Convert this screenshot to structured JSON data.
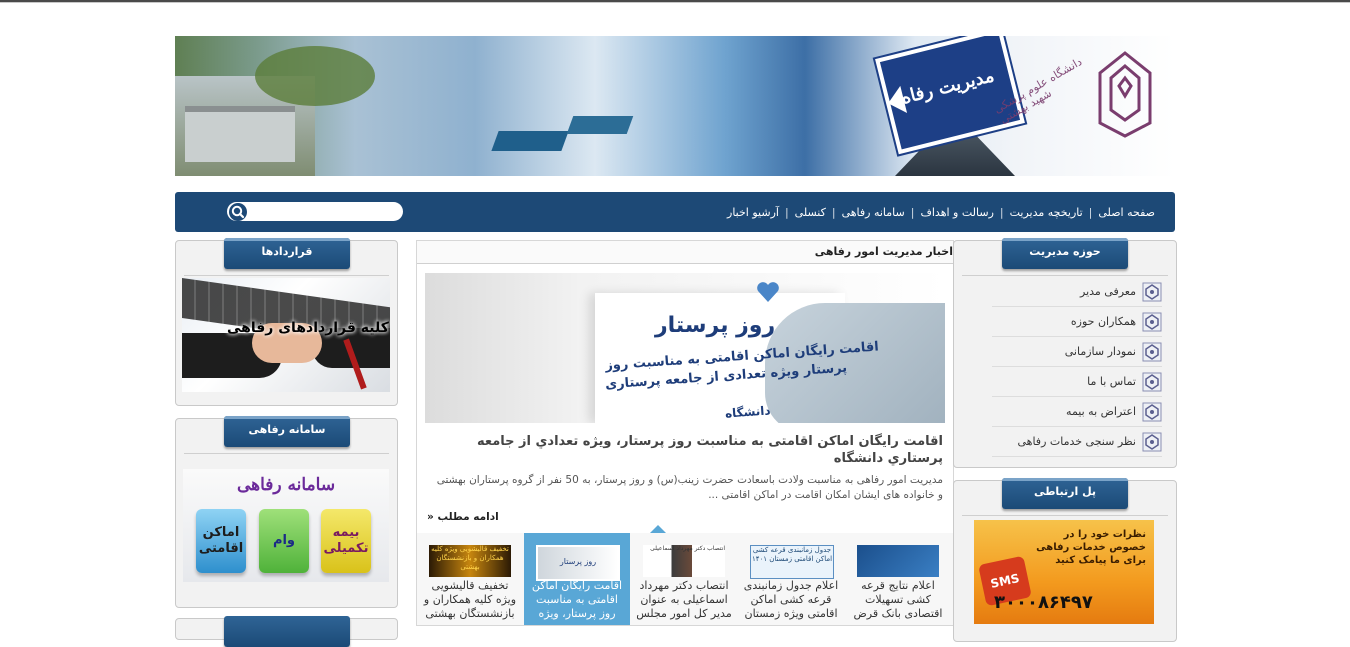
{
  "banner": {
    "sign_text": "مدیریت رفاه",
    "university_text": "دانشگاه علوم پزشکی شهید بهشتی"
  },
  "nav": {
    "items": [
      {
        "label": "صفحه اصلی"
      },
      {
        "label": "تاریخچه مدیریت"
      },
      {
        "label": "رسالت و اهداف"
      },
      {
        "label": "سامانه رفاهی"
      },
      {
        "label": "کنسلی"
      },
      {
        "label": "آرشیو اخبار"
      }
    ],
    "separator": "|",
    "search_placeholder": ""
  },
  "right_box": {
    "title": "حوزه مدیریت",
    "items": [
      {
        "label": "معرفی مدیر"
      },
      {
        "label": "همکاران حوزه"
      },
      {
        "label": "نمودار سازمانی"
      },
      {
        "label": "تماس با ما"
      },
      {
        "label": "اعتراض به بیمه"
      },
      {
        "label": "نظر سنجی خدمات رفاهی"
      }
    ]
  },
  "link_box": {
    "title": "پل ارتباطی",
    "sms_text": "نظرات خود را در خصوص خدمات رفاهی برای ما پیامک کنید",
    "sms_badge": "SMS",
    "sms_number": "۳۰۰۰۸۶۴۹۷"
  },
  "contracts_box": {
    "title": "قراردادها",
    "image_caption": "کلیه قراردادهای رفاهی"
  },
  "samaneh_box": {
    "title": "سامانه رفاهی",
    "image_title": "سامانه رفاهی",
    "cubes": [
      "بیمه تکمیلی",
      "وام",
      "اماکن اقامتی"
    ]
  },
  "news": {
    "section_title": "اخبار مدیریت امور رفاهی",
    "image_lines": [
      "روز پرستار",
      "اقامت رایگان اماکن اقامتی به مناسبت روز",
      "پرستار ویژه تعدادی از جامعه پرستاری",
      "دانشگاه"
    ],
    "headline": "اقامت رايگان اماكن اقامتی به مناسبت روز پرستار، ويژه تعدادي از جامعه پرستاري دانشگاه",
    "summary": "مدیریت امور رفاهی به مناسبت ولادت باسعادت حضرت زینب(س) و روز پرستار، به 50 نفر از گروه پرستاران بهشتی و خانواده های ایشان امکان اقامت در اماکن اقامتی ...",
    "more_label": "» ادامه مطلب",
    "thumbs": [
      {
        "text": "تخفیف قالیشویی ویژه کلیه همکاران و بازنشستگان بهشتی",
        "img_text": "تخفیف قالیشویی ویژه کلیه همکاران و بازنشستگان بهشتی"
      },
      {
        "text": "اقامت رايگان اماكن اقامتی به مناسبت روز پرستار، ويژه",
        "img_text": "روز پرستار"
      },
      {
        "text": "انتصاب دکتر مهرداد اسماعیلی به عنوان مدیر کل امور مجلس",
        "img_text": "انتصاب دکتر مهرداد اسماعیلی"
      },
      {
        "text": "اعلام جدول زمانبندی قرعه کشی اماکن اقامتی ویژه زمستان",
        "img_text": "جدول زمانبندی قرعه کشی اماکن اقامتی زمستان ۱۴۰۱"
      },
      {
        "text": "اعلام نتایج قرعه کشی تسهیلات اقتصادی بانک قرض",
        "img_text": ""
      }
    ]
  },
  "colors": {
    "nav_bg": "#1d4976",
    "tab_bg": "#2f6496",
    "active_thumb": "#59a7d6"
  }
}
